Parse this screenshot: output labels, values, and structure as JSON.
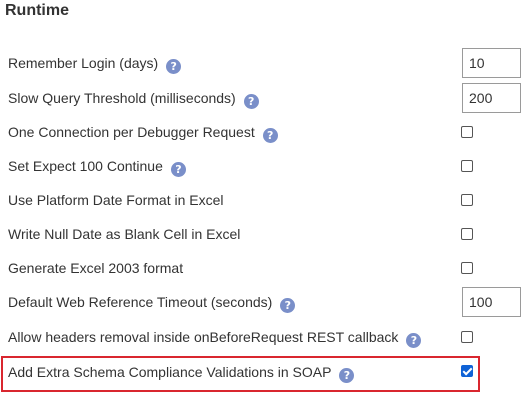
{
  "section": {
    "title": "Runtime"
  },
  "settings": [
    {
      "label": "Remember Login (days)",
      "control": "text",
      "value": "10"
    },
    {
      "label": "Slow Query Threshold (milliseconds)",
      "control": "text",
      "value": "200"
    },
    {
      "label": "One Connection per Debugger Request",
      "control": "checkbox",
      "checked": false
    },
    {
      "label": "Set Expect 100 Continue",
      "control": "checkbox",
      "checked": false
    },
    {
      "label": "Use Platform Date Format in Excel",
      "control": "checkbox",
      "checked": false
    },
    {
      "label": "Write Null Date as Blank Cell in Excel",
      "control": "checkbox",
      "checked": false
    },
    {
      "label": "Generate Excel 2003 format",
      "control": "checkbox",
      "checked": false
    },
    {
      "label": "Default Web Reference Timeout (seconds)",
      "control": "text",
      "value": "100"
    },
    {
      "label": "Allow headers removal inside onBeforeRequest REST callback",
      "control": "checkbox",
      "checked": false
    },
    {
      "label": "Add Extra Schema Compliance Validations in SOAP",
      "control": "checkbox",
      "checked": true,
      "highlighted": true
    }
  ],
  "help_icon": {
    "glyph": "?",
    "icon": "question-circle-icon",
    "color": "#7a8fc9"
  },
  "colors": {
    "highlight_border": "#d9262f",
    "checkbox_checked": "#0f62d6"
  }
}
